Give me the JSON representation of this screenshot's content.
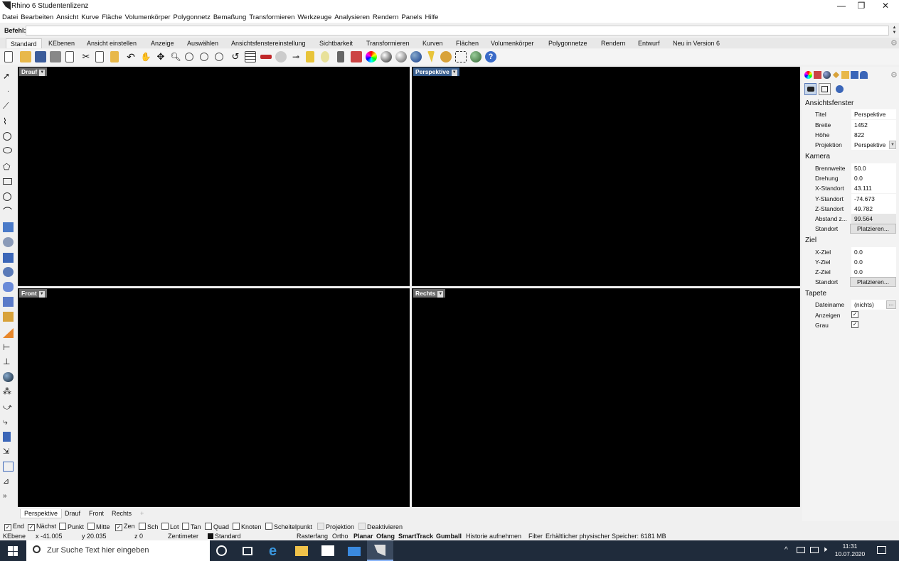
{
  "window": {
    "title": "Rhino 6 Studentenlizenz",
    "controls": [
      "—",
      "❐",
      "✕"
    ]
  },
  "menu": [
    "Datei",
    "Bearbeiten",
    "Ansicht",
    "Kurve",
    "Fläche",
    "Volumenkörper",
    "Polygonnetz",
    "Bemaßung",
    "Transformieren",
    "Werkzeuge",
    "Analysieren",
    "Rendern",
    "Panels",
    "Hilfe"
  ],
  "command": {
    "label": "Befehl:",
    "value": ""
  },
  "tabs": [
    "Standard",
    "KEbenen",
    "Ansicht einstellen",
    "Anzeige",
    "Auswählen",
    "Ansichtsfenstereinstellung",
    "Sichtbarkeit",
    "Transformieren",
    "Kurven",
    "Flächen",
    "Volumenkörper",
    "Polygonnetze",
    "Rendern",
    "Entwurf",
    "Neu in Version 6"
  ],
  "viewports": {
    "top": "Drauf",
    "perspective": "Perspektive",
    "front": "Front",
    "right": "Rechts"
  },
  "panel": {
    "sections": {
      "viewport": "Ansichtsfenster",
      "camera": "Kamera",
      "target": "Ziel",
      "wallpaper": "Tapete"
    },
    "viewport_rows": [
      {
        "key": "Titel",
        "value": "Perspektive"
      },
      {
        "key": "Breite",
        "value": "1452"
      },
      {
        "key": "Höhe",
        "value": "822"
      },
      {
        "key": "Projektion",
        "value": "Perspektive"
      }
    ],
    "camera_rows": [
      {
        "key": "Brennweite",
        "value": "50.0"
      },
      {
        "key": "Drehung",
        "value": "0.0"
      },
      {
        "key": "X-Standort",
        "value": "43.111"
      },
      {
        "key": "Y-Standort",
        "value": "-74.673"
      },
      {
        "key": "Z-Standort",
        "value": "49.782"
      },
      {
        "key": "Abstand z...",
        "value": "99.564"
      }
    ],
    "camera_location": {
      "key": "Standort",
      "button": "Platzieren..."
    },
    "target_rows": [
      {
        "key": "X-Ziel",
        "value": "0.0"
      },
      {
        "key": "Y-Ziel",
        "value": "0.0"
      },
      {
        "key": "Z-Ziel",
        "value": "0.0"
      }
    ],
    "target_location": {
      "key": "Standort",
      "button": "Platzieren..."
    },
    "wallpaper_rows": [
      {
        "key": "Dateiname",
        "value": "(nichts)"
      },
      {
        "key": "Anzeigen",
        "checked": true
      },
      {
        "key": "Grau",
        "checked": true
      }
    ],
    "ellipsis": "..."
  },
  "viewport_tabs": [
    "Perspektive",
    "Drauf",
    "Front",
    "Rechts"
  ],
  "osnaps": [
    {
      "label": "End",
      "checked": true
    },
    {
      "label": "Nächst",
      "checked": true
    },
    {
      "label": "Punkt",
      "checked": false
    },
    {
      "label": "Mitte",
      "checked": false
    },
    {
      "label": "Zen",
      "checked": true
    },
    {
      "label": "Sch",
      "checked": false
    },
    {
      "label": "Lot",
      "checked": false
    },
    {
      "label": "Tan",
      "checked": false
    },
    {
      "label": "Quad",
      "checked": false
    },
    {
      "label": "Knoten",
      "checked": false
    },
    {
      "label": "Scheitelpunkt",
      "checked": false
    },
    {
      "label": "Projektion",
      "checked": false
    },
    {
      "label": "Deaktivieren",
      "checked": false
    }
  ],
  "status": {
    "plane": "KEbene",
    "x": "x -41.005",
    "y": "y 20.035",
    "z": "z 0",
    "unit": "Zentimeter",
    "layer": "Standard",
    "grid_snap": "Rasterfang",
    "ortho": "Ortho",
    "planar": "Planar",
    "osnap": "Ofang",
    "smarttrack": "SmartTrack",
    "gumball": "Gumball",
    "history": "Historie aufnehmen",
    "filter": "Filter",
    "memory": "Erhältlicher physischer Speicher: 6181 MB"
  },
  "taskbar": {
    "search_placeholder": "Zur Suche Text hier eingeben",
    "time": "11:31",
    "date": "10.07.2020"
  },
  "colors": {
    "viewport_bg": "#000000",
    "active_label": "#3a5f8f",
    "taskbar": "#1f2b3b"
  }
}
